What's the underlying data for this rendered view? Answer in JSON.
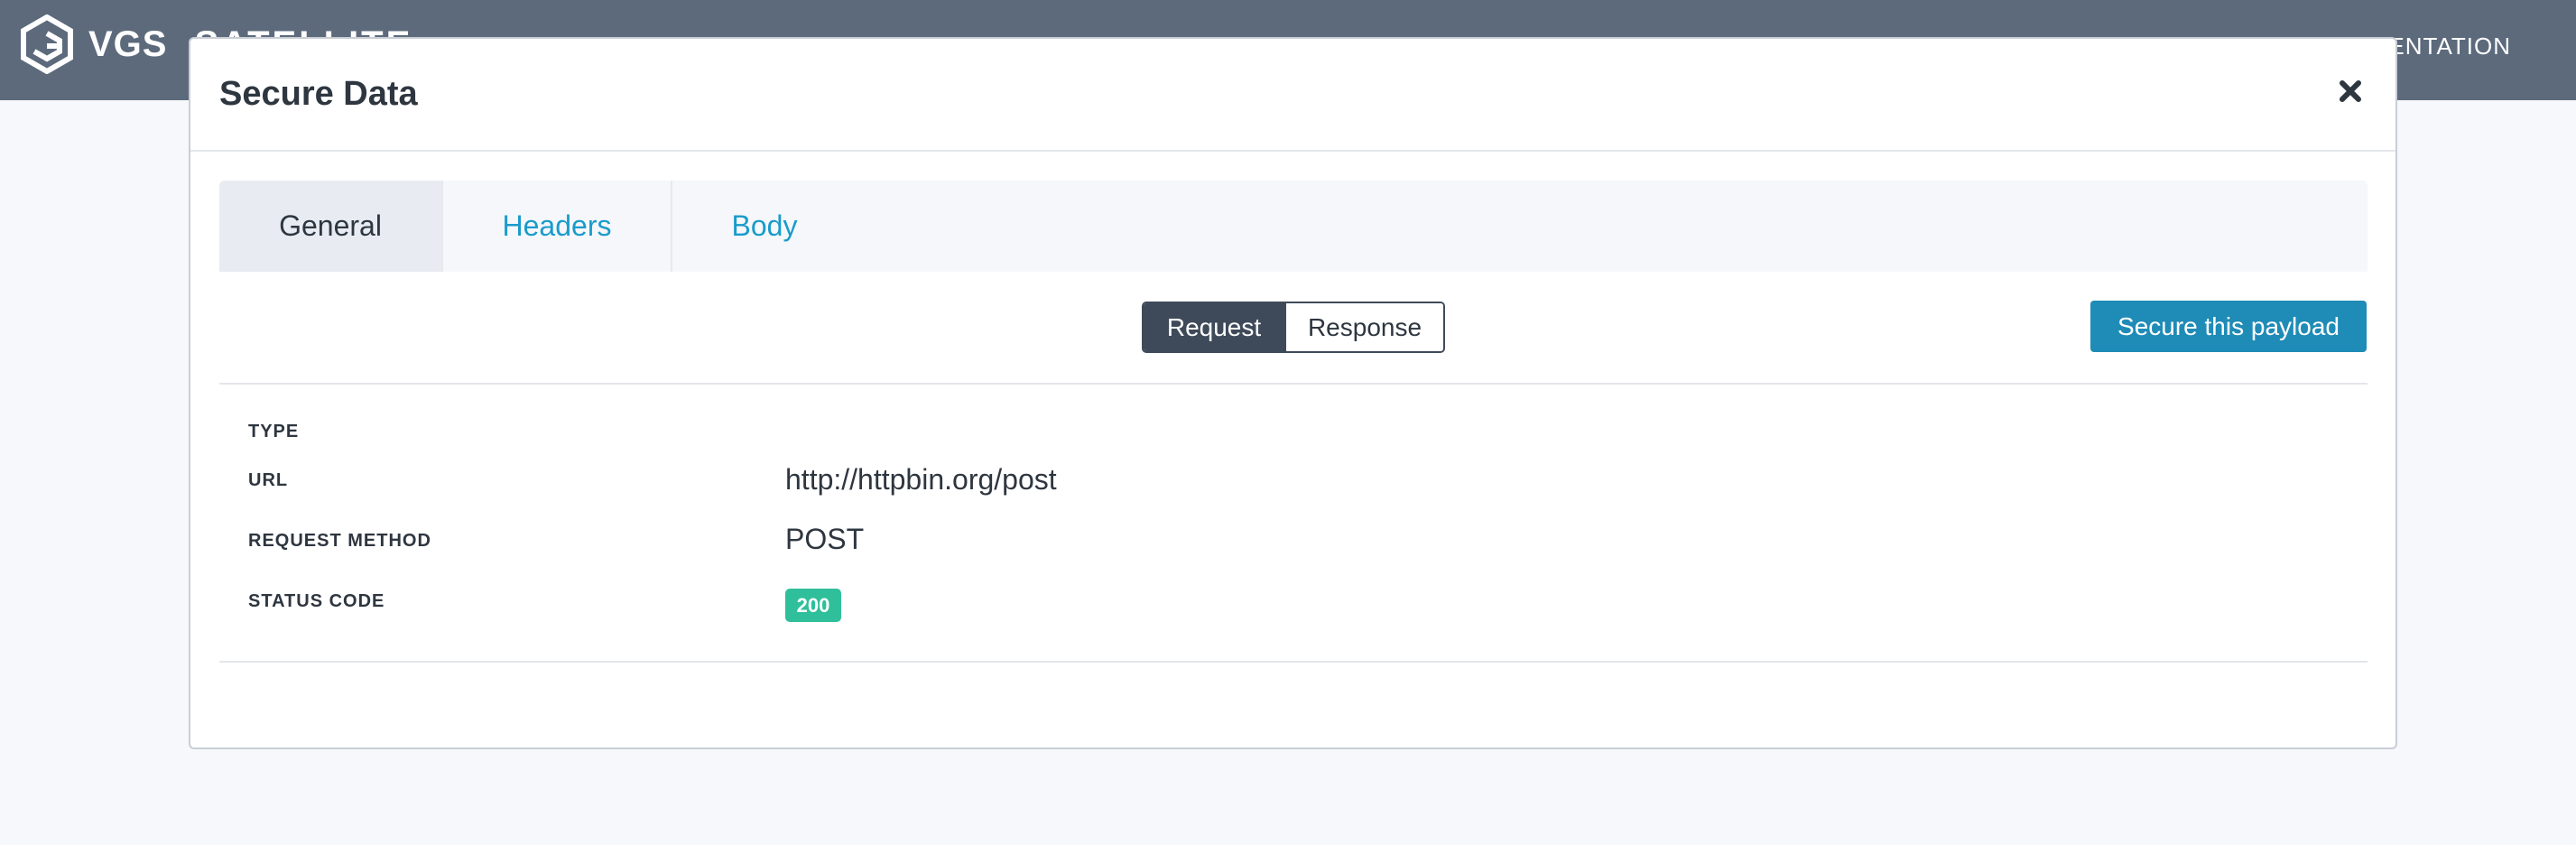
{
  "app": {
    "brand_name": "VGS",
    "brand_sub": "SATELLITE",
    "nav_right": "ENTATION",
    "colors": {
      "topbar": "#5c6a7c",
      "accent": "#1f8bb7",
      "tab_link": "#1a9bcb",
      "status_ok": "#2fbf9b",
      "segment_active": "#3e4a59"
    }
  },
  "modal": {
    "title": "Secure Data",
    "close_icon": "close-icon",
    "tabs": [
      {
        "label": "General",
        "active": true
      },
      {
        "label": "Headers",
        "active": false
      },
      {
        "label": "Body",
        "active": false
      }
    ],
    "toggle": {
      "request_label": "Request",
      "response_label": "Response",
      "selected": "Request"
    },
    "secure_button_label": "Secure this payload",
    "fields": {
      "type_label": "TYPE",
      "type_value": "",
      "url_label": "URL",
      "url_value": "http://httpbin.org/post",
      "method_label": "REQUEST METHOD",
      "method_value": "POST",
      "status_label": "STATUS CODE",
      "status_value": "200"
    }
  }
}
